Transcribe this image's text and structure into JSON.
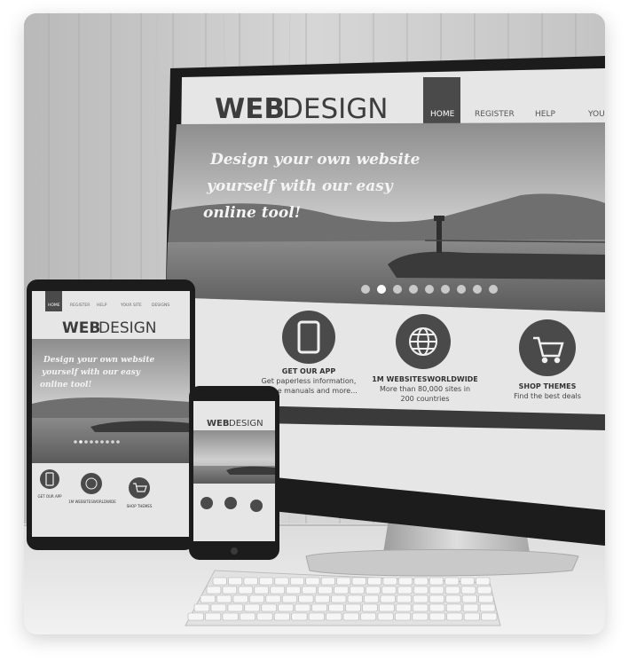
{
  "monitor": {
    "logo_bold": "WEB",
    "logo_light": "DESIGN",
    "nav": [
      "HOME",
      "REGISTER",
      "HELP",
      "YOU"
    ],
    "hero_lines": [
      "Design your own website",
      "yourself with our easy",
      "online tool!"
    ],
    "carousel": {
      "count": 9,
      "active_index": 1
    },
    "features": [
      {
        "title": "GET OUR APP",
        "lines": [
          "Get paperless information,",
          "online manuals and more..."
        ],
        "icon": "phone-icon"
      },
      {
        "title": "1M WEBSITESWORLDWIDE",
        "lines": [
          "More than 80,000 sites in",
          "200 countries"
        ],
        "icon": "globe-icon"
      },
      {
        "title": "SHOP THEMES",
        "lines": [
          "Find the best deals"
        ],
        "icon": "cart-icon"
      }
    ]
  },
  "tablet": {
    "logo_bold": "WEB",
    "logo_light": "DESIGN",
    "nav": [
      "HOME",
      "REGISTER",
      "HELP",
      "YOUR SITE",
      "DESIGNS"
    ],
    "hero_lines": [
      "Design your own website",
      "yourself with our easy",
      "online tool!"
    ],
    "features": [
      "GET OUR APP",
      "1M WEBSITESWORLDWIDE",
      "SHOP THEMES"
    ]
  },
  "phone": {
    "logo_bold": "WEB",
    "logo_light": "DESIGN"
  },
  "colors": {
    "dark": "#3d3d3d",
    "frame": "#1c1c1c",
    "screen_bg": "#e6e6e6"
  }
}
